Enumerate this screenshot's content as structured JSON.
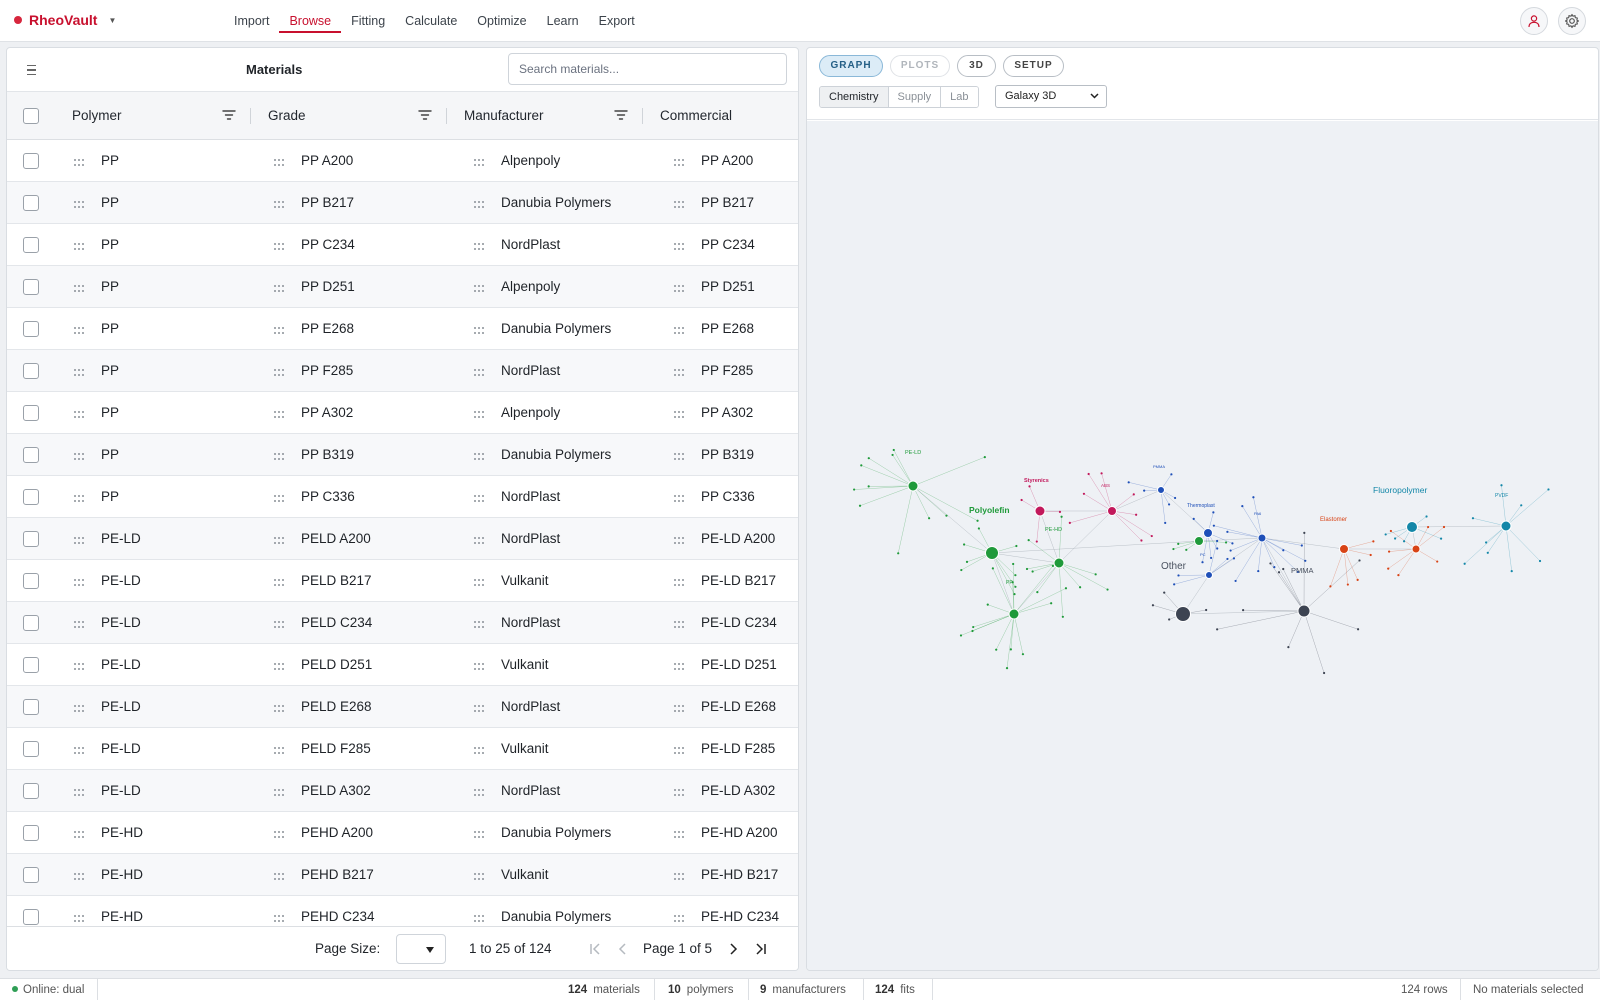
{
  "app": {
    "name": "RheoVault"
  },
  "nav": {
    "items": [
      "Import",
      "Browse",
      "Fitting",
      "Calculate",
      "Optimize",
      "Learn",
      "Export"
    ],
    "active": "Browse"
  },
  "materials_panel": {
    "title": "Materials",
    "search_placeholder": "Search materials...",
    "columns": [
      "Polymer",
      "Grade",
      "Manufacturer",
      "Commercial"
    ],
    "rows": [
      [
        "PP",
        "PP A200",
        "Alpenpoly",
        "PP A200"
      ],
      [
        "PP",
        "PP B217",
        "Danubia Polymers",
        "PP B217"
      ],
      [
        "PP",
        "PP C234",
        "NordPlast",
        "PP C234"
      ],
      [
        "PP",
        "PP D251",
        "Alpenpoly",
        "PP D251"
      ],
      [
        "PP",
        "PP E268",
        "Danubia Polymers",
        "PP E268"
      ],
      [
        "PP",
        "PP F285",
        "NordPlast",
        "PP F285"
      ],
      [
        "PP",
        "PP A302",
        "Alpenpoly",
        "PP A302"
      ],
      [
        "PP",
        "PP B319",
        "Danubia Polymers",
        "PP B319"
      ],
      [
        "PP",
        "PP C336",
        "NordPlast",
        "PP C336"
      ],
      [
        "PE-LD",
        "PELD A200",
        "NordPlast",
        "PE-LD A200"
      ],
      [
        "PE-LD",
        "PELD B217",
        "Vulkanit",
        "PE-LD B217"
      ],
      [
        "PE-LD",
        "PELD C234",
        "NordPlast",
        "PE-LD C234"
      ],
      [
        "PE-LD",
        "PELD D251",
        "Vulkanit",
        "PE-LD D251"
      ],
      [
        "PE-LD",
        "PELD E268",
        "NordPlast",
        "PE-LD E268"
      ],
      [
        "PE-LD",
        "PELD F285",
        "Vulkanit",
        "PE-LD F285"
      ],
      [
        "PE-LD",
        "PELD A302",
        "NordPlast",
        "PE-LD A302"
      ],
      [
        "PE-HD",
        "PEHD A200",
        "Danubia Polymers",
        "PE-HD A200"
      ],
      [
        "PE-HD",
        "PEHD B217",
        "Vulkanit",
        "PE-HD B217"
      ],
      [
        "PE-HD",
        "PEHD C234",
        "Danubia Polymers",
        "PE-HD C234"
      ]
    ],
    "pager": {
      "page_size_label": "Page Size:",
      "range": "1 to 25 of 124",
      "page_label": "Page 1 of 5"
    }
  },
  "graph_panel": {
    "view_tabs": [
      "GRAPH",
      "PLOTS",
      "3D",
      "SETUP"
    ],
    "active_view": "GRAPH",
    "disabled_view": "PLOTS",
    "group_tabs": [
      "Chemistry",
      "Supply",
      "Lab"
    ],
    "active_group": "Chemistry",
    "layout_select": "Galaxy 3D",
    "clusters": [
      {
        "label": "Polyolefin",
        "color": "#1f9a3a"
      },
      {
        "label": "PE-LD",
        "color": "#1f9a3a"
      },
      {
        "label": "PE-HD",
        "color": "#1f9a3a"
      },
      {
        "label": "PP",
        "color": "#1f9a3a"
      },
      {
        "label": "Styrenics",
        "color": "#c2185b"
      },
      {
        "label": "ABS",
        "color": "#c2185b"
      },
      {
        "label": "PMMA",
        "color": "#1e4fb8"
      },
      {
        "label": "Thermoplast",
        "color": "#1e4fb8"
      },
      {
        "label": "PA6",
        "color": "#1e4fb8"
      },
      {
        "label": "PC",
        "color": "#1e4fb8"
      },
      {
        "label": "Other",
        "color": "#3d4452"
      },
      {
        "label": "PMMA",
        "color": "#3d4452"
      },
      {
        "label": "Elastomer",
        "color": "#d84315"
      },
      {
        "label": "Fluoropolymer",
        "color": "#1387a8"
      },
      {
        "label": "PVDF",
        "color": "#1387a8"
      }
    ]
  },
  "statusbar": {
    "online": "Online: dual",
    "materials_count": "124",
    "materials_label": "materials",
    "polymers_count": "10",
    "polymers_label": "polymers",
    "manufacturers_count": "9",
    "manufacturers_label": "manufacturers",
    "fits_count": "124",
    "fits_label": "fits",
    "rows_text": "124 rows",
    "selection_text": "No materials selected"
  },
  "colors": {
    "brand": "#c8102e",
    "active_pill_bg": "#dcecf7",
    "canvas_bg": "#eef1f5"
  }
}
